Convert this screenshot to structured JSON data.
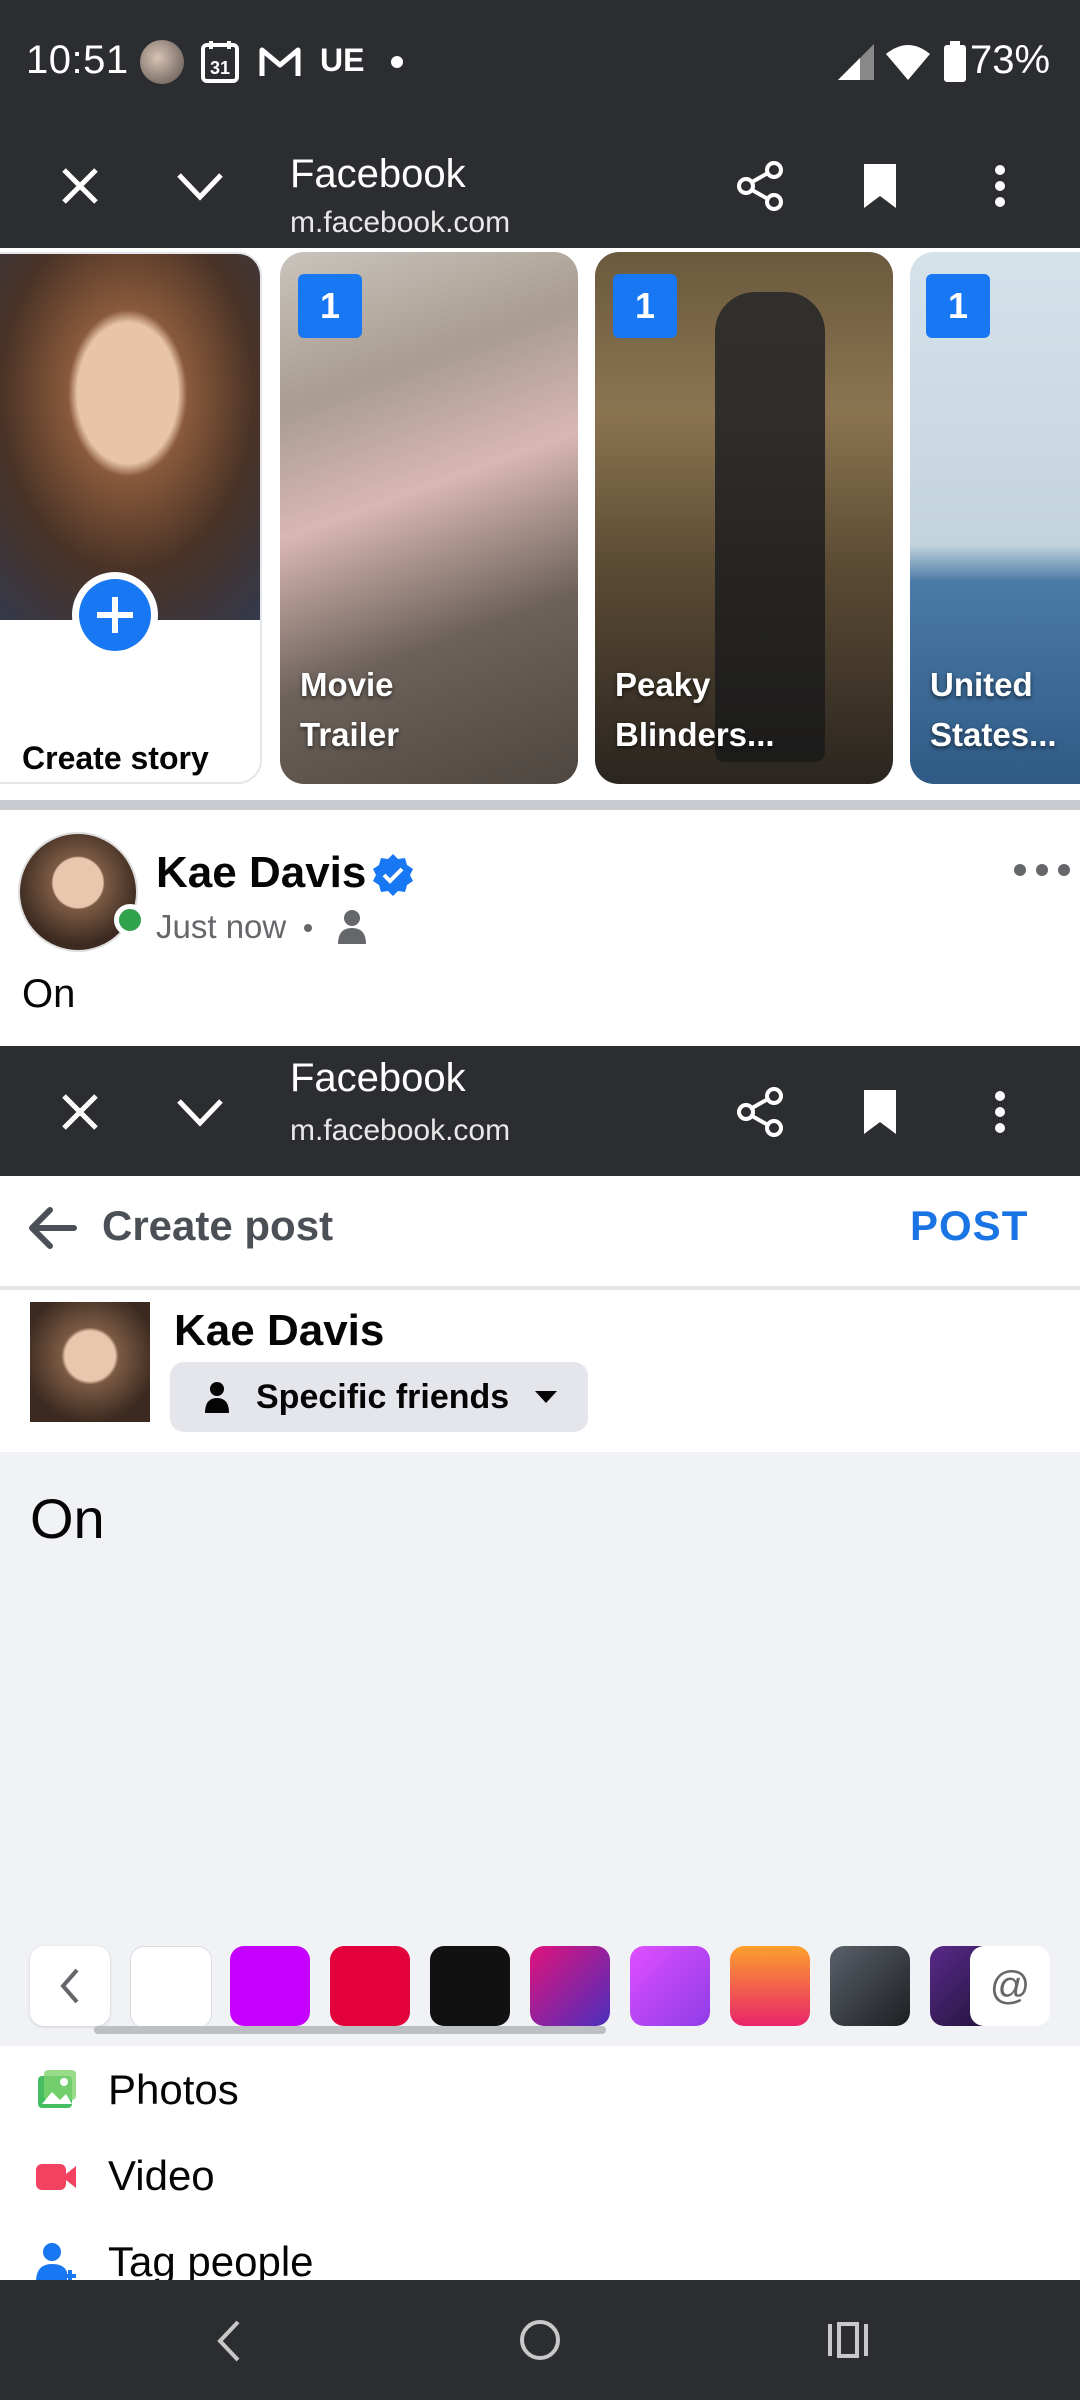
{
  "status_bar": {
    "time": "10:51",
    "calendar_day": "31",
    "carrier_tag": "UE",
    "battery": "73%"
  },
  "browser_top": {
    "title": "Facebook",
    "url": "m.facebook.com"
  },
  "browser_mid": {
    "title": "Facebook",
    "url": "m.facebook.com"
  },
  "stories": [
    {
      "label": "Create story"
    },
    {
      "badge": "1",
      "line1": "Movie",
      "line2": "Trailer"
    },
    {
      "badge": "1",
      "line1": "Peaky",
      "line2": "Blinders..."
    },
    {
      "badge": "1",
      "line1": "United",
      "line2": "States..."
    }
  ],
  "post": {
    "author": "Kae Davis",
    "time": "Just now",
    "text": "On"
  },
  "create_post": {
    "title": "Create post",
    "post_button": "POST",
    "author": "Kae Davis",
    "audience": "Specific friends",
    "text": "On",
    "mention_symbol": "@",
    "background_swatches": [
      "#ffffff",
      "#c600ff",
      "#e2013b",
      "#111111",
      "linear-gradient(135deg,#e0137a,#4a2fbd)",
      "linear-gradient(135deg,#e04fff,#8d3ce8)",
      "linear-gradient(180deg,#fda02d,#e8246a)",
      "linear-gradient(135deg,#5b616b,#1c1e21)",
      "linear-gradient(135deg,#5a2a8a,#1a1030)"
    ],
    "options": [
      {
        "label": "Photos",
        "icon": "photos-icon",
        "color": "#45bd62"
      },
      {
        "label": "Video",
        "icon": "video-icon",
        "color": "#f3425f"
      },
      {
        "label": "Tag people",
        "icon": "tag-people-icon",
        "color": "#1877f2"
      }
    ]
  },
  "colors": {
    "chrome": "#2b2d31",
    "facebook_blue": "#1877f2",
    "post_blue": "#1b74e4",
    "composer_bg": "#f0f2f5"
  }
}
